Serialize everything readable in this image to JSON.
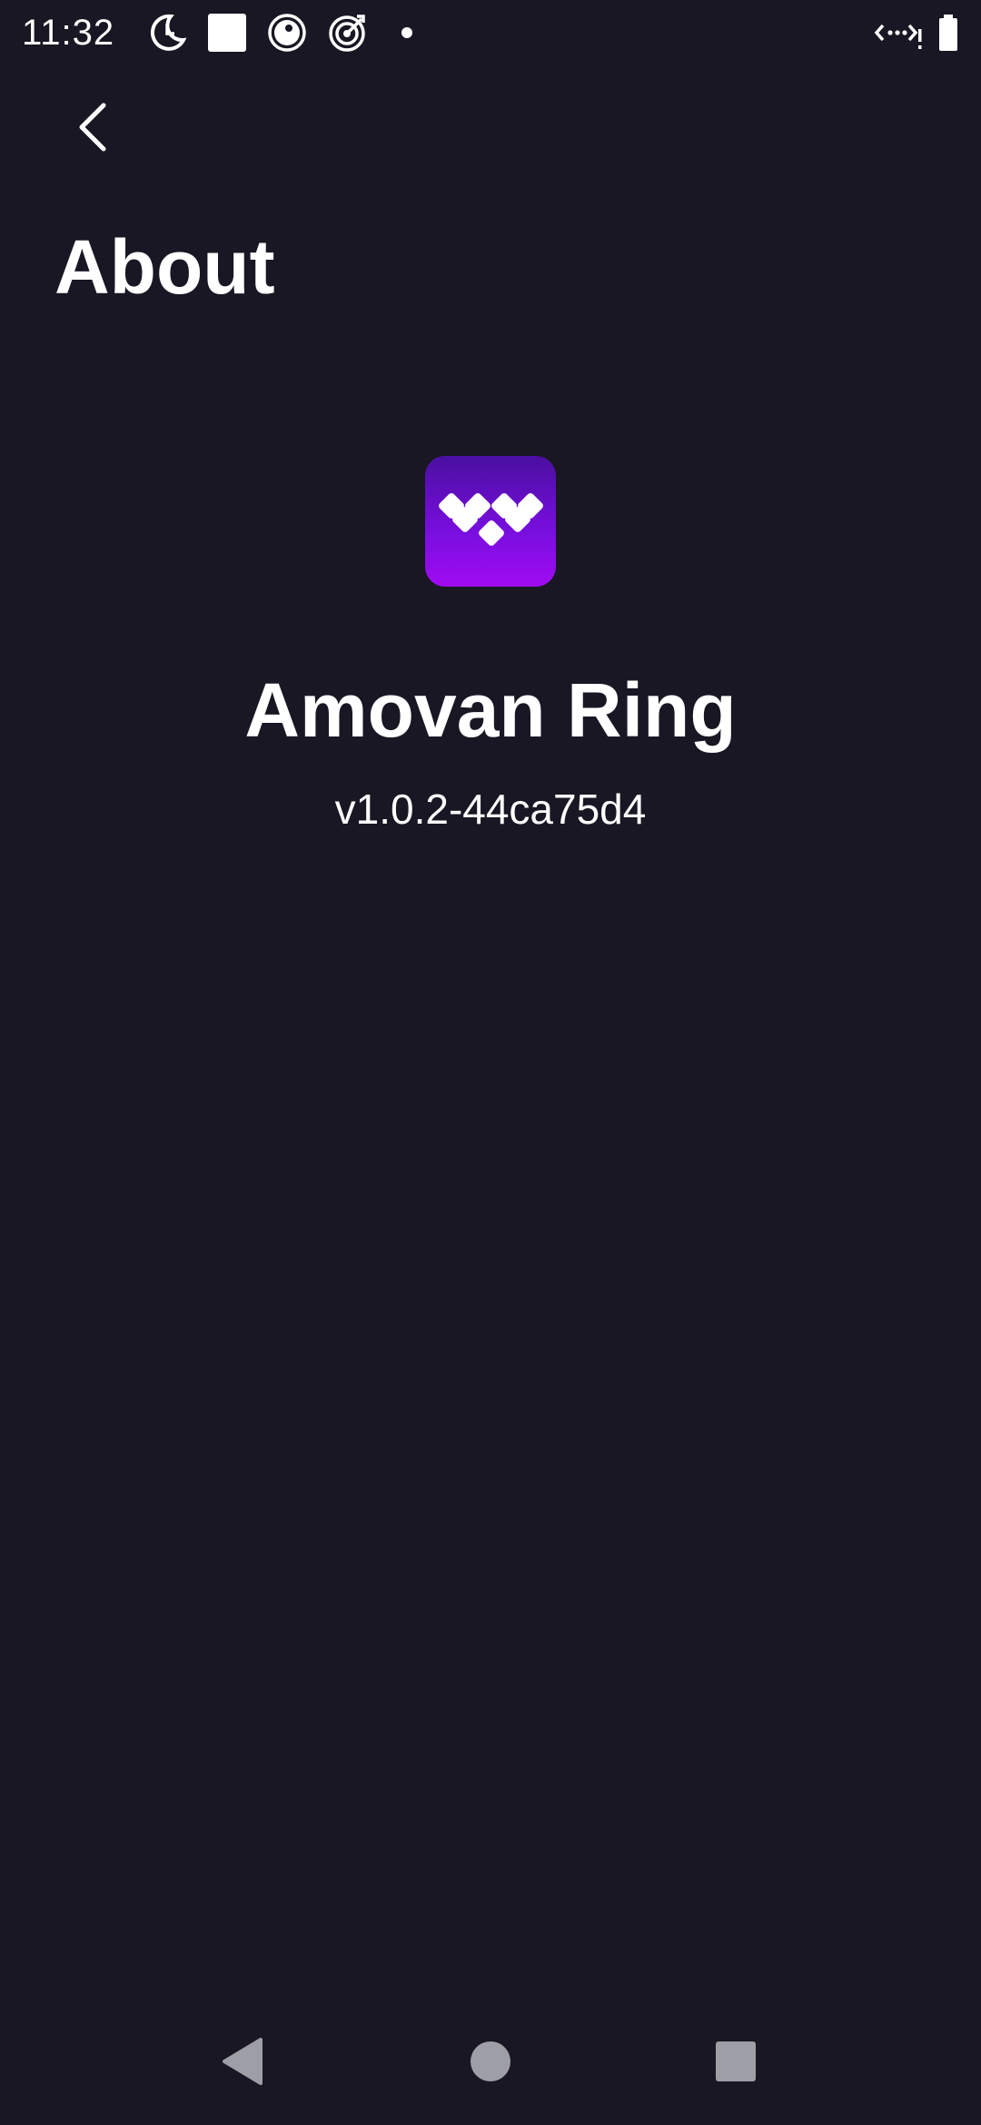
{
  "status_bar": {
    "time": "11:32",
    "left_icons": [
      "clock-moon-icon",
      "square-notification-icon",
      "circle-dot-icon",
      "target-icon",
      "dot-icon"
    ],
    "right_icons": [
      "data-saver-icon",
      "battery-icon"
    ]
  },
  "app_bar": {
    "back_icon": "chevron-left-icon",
    "title": "About"
  },
  "app_info": {
    "logo_icon": "amovan-diamond-logo",
    "name": "Amovan Ring",
    "version": "v1.0.2-44ca75d4"
  },
  "nav_bar": {
    "back_icon": "triangle-back-icon",
    "home_icon": "circle-home-icon",
    "recents_icon": "square-recents-icon"
  },
  "colors": {
    "background": "#181723",
    "text": "#ffffff",
    "logo_top": "#4a0fa0",
    "logo_bottom": "#a10bf2",
    "nav_icon": "#9e9ea6"
  }
}
